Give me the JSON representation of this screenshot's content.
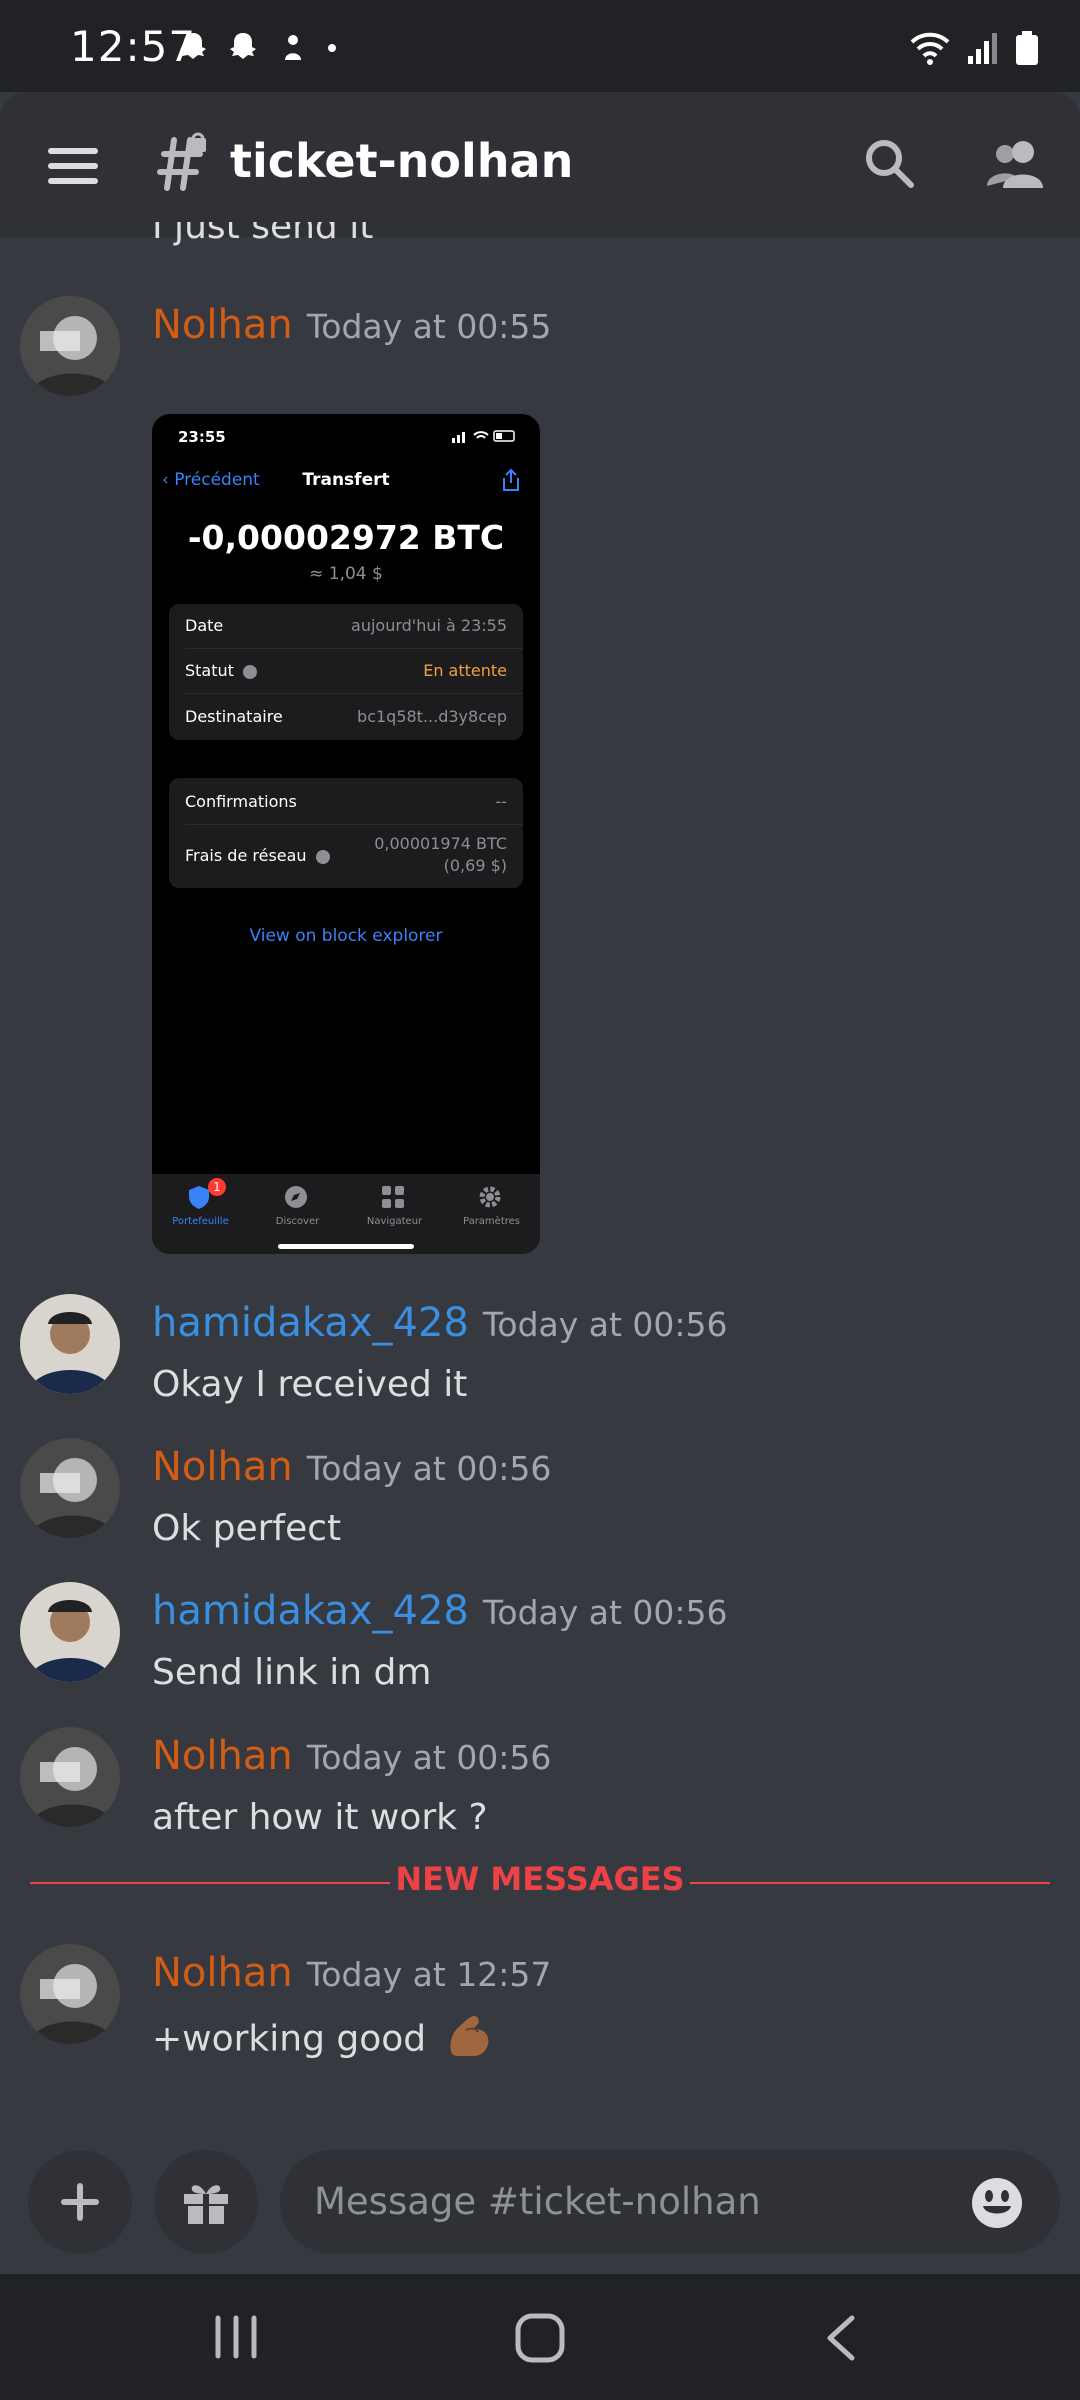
{
  "status_bar": {
    "time": "12:57"
  },
  "header": {
    "channel": "ticket-nolhan"
  },
  "partial_message": "I just send it",
  "messages": [
    {
      "author": "Nolhan",
      "time": "Today at 00:55"
    },
    {
      "author": "hamidakax_428",
      "time": "Today at 00:56",
      "text": "Okay I received it"
    },
    {
      "author": "Nolhan",
      "time": "Today at 00:56",
      "text": "Ok perfect"
    },
    {
      "author": "hamidakax_428",
      "time": "Today at 00:56",
      "text": "Send link in dm"
    },
    {
      "author": "Nolhan",
      "time": "Today at 00:56",
      "text": "after how it work ?"
    },
    {
      "author": "Nolhan",
      "time": "Today at 12:57",
      "text": "+working good",
      "emoji": "💪🏽"
    }
  ],
  "new_messages_label": "NEW MESSAGES",
  "attachment": {
    "time": "23:55",
    "back_label": "Précédent",
    "title": "Transfert",
    "amount": "-0,00002972 BTC",
    "fiat": "≈ 1,04 $",
    "rows1": [
      {
        "label": "Date",
        "value": "aujourd'hui à 23:55"
      },
      {
        "label": "Statut",
        "value": "En attente"
      },
      {
        "label": "Destinataire",
        "value": "bc1q58t...d3y8cep"
      }
    ],
    "rows2": [
      {
        "label": "Confirmations",
        "value": "--"
      },
      {
        "label": "Frais de réseau",
        "value": "0,00001974 BTC",
        "value2": "(0,69 $)"
      }
    ],
    "explorer_link": "View on block explorer",
    "tabs": [
      "Portefeuille",
      "Discover",
      "Navigateur",
      "Paramètres"
    ],
    "badge": "1"
  },
  "input": {
    "placeholder": "Message #ticket-nolhan"
  },
  "colors": {
    "nolhan": "#d35d15",
    "hamid": "#3a8fe0",
    "new_messages": "#ed4245",
    "background": "#36393f"
  }
}
